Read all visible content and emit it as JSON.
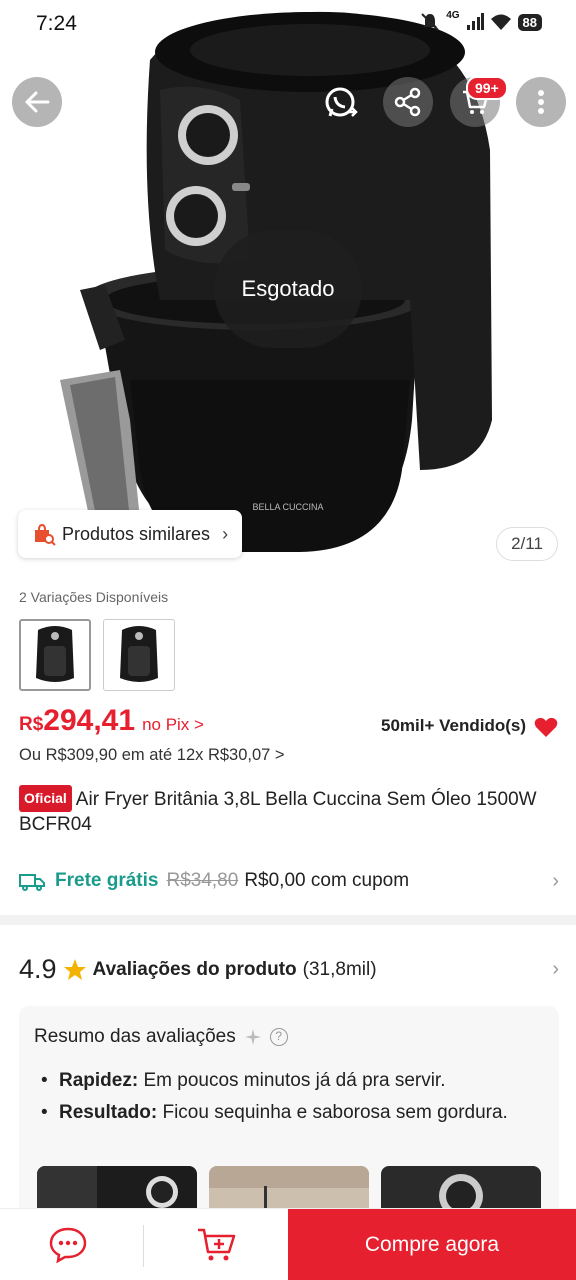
{
  "status_bar": {
    "time": "7:24",
    "network": "4G",
    "battery": "88"
  },
  "top_nav": {
    "cart_badge": "99+"
  },
  "gallery": {
    "overlay_text": "Esgotado",
    "similar_products_label": "Produtos similares",
    "page_indicator": "2/11"
  },
  "variants": {
    "label": "2 Variações Disponíveis",
    "count": 2
  },
  "pricing": {
    "currency": "R$",
    "price": "294,41",
    "pix_label": "no Pix >",
    "installments": "Ou R$309,90 em até 12x R$30,07 >",
    "sold": "50mil+ Vendido(s)"
  },
  "product": {
    "badge": "Oficial",
    "title": "Air Fryer Britânia 3,8L Bella Cuccina Sem Óleo 1500W BCFR04"
  },
  "shipping": {
    "free_label": "Frete grátis",
    "old_price": "R$34,80",
    "coupon_text": "R$0,00 com cupom"
  },
  "reviews": {
    "rating": "4.9",
    "title": "Avaliações do produto",
    "count": "(31,8mil)",
    "summary_title": "Resumo das avaliações",
    "items": [
      {
        "label": "Rapidez:",
        "text": "Em poucos minutos já dá pra servir."
      },
      {
        "label": "Resultado:",
        "text": "Ficou sequinha e saborosa sem gordura."
      }
    ]
  },
  "bottom_bar": {
    "buy_label": "Compre agora"
  },
  "colors": {
    "accent": "#e6202f",
    "shipping": "#1a9c8c"
  }
}
